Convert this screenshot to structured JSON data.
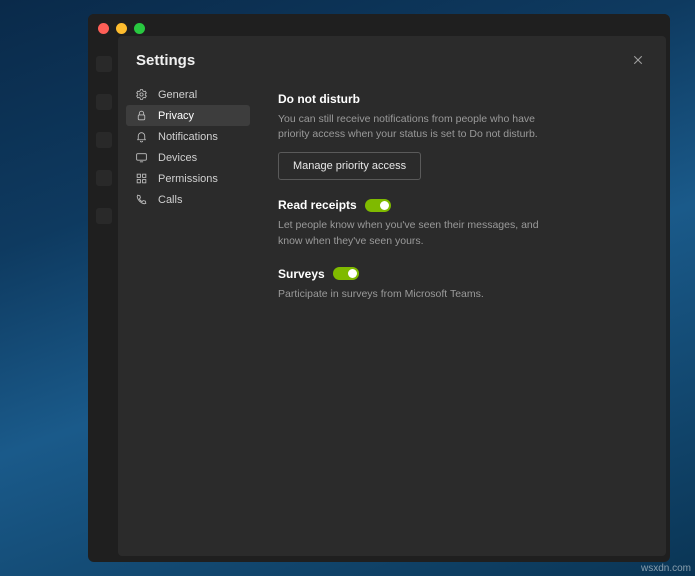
{
  "panel": {
    "title": "Settings"
  },
  "nav": {
    "items": [
      {
        "label": "General"
      },
      {
        "label": "Privacy"
      },
      {
        "label": "Notifications"
      },
      {
        "label": "Devices"
      },
      {
        "label": "Permissions"
      },
      {
        "label": "Calls"
      }
    ],
    "active_index": 1
  },
  "content": {
    "dnd": {
      "title": "Do not disturb",
      "desc": "You can still receive notifications from people who have priority access when your status is set to Do not disturb.",
      "button": "Manage priority access"
    },
    "read_receipts": {
      "title": "Read receipts",
      "desc": "Let people know when you've seen their messages, and know when they've seen yours.",
      "enabled": true
    },
    "surveys": {
      "title": "Surveys",
      "desc": "Participate in surveys from Microsoft Teams.",
      "enabled": true
    }
  },
  "watermark": "wsxdn.com"
}
